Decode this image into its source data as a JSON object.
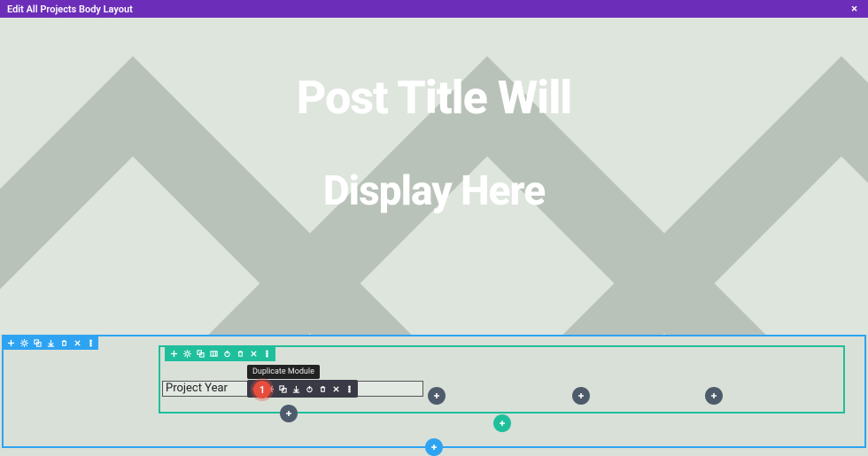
{
  "header": {
    "title": "Edit All Projects Body Layout",
    "close": "×"
  },
  "hero": {
    "line1": "Post Title Will",
    "line2": "Display Here"
  },
  "module": {
    "label": "Project Year"
  },
  "tooltip": {
    "text": "Duplicate Module"
  },
  "step_badge": {
    "number": "1"
  },
  "icons": {
    "plus": "+",
    "gear": "⚙",
    "duplicate": "⧉",
    "columns": "▥",
    "power": "⏻",
    "trash": "🗑",
    "close": "✕",
    "dots": "⋮",
    "download": "⇩",
    "copy": "⎘"
  },
  "colors": {
    "purple": "#6c2eb9",
    "blue": "#2ea3f2",
    "teal": "#1fbf9c",
    "dark": "#3a3a47",
    "red": "#e74c3c",
    "grey": "#4d5b6b"
  }
}
